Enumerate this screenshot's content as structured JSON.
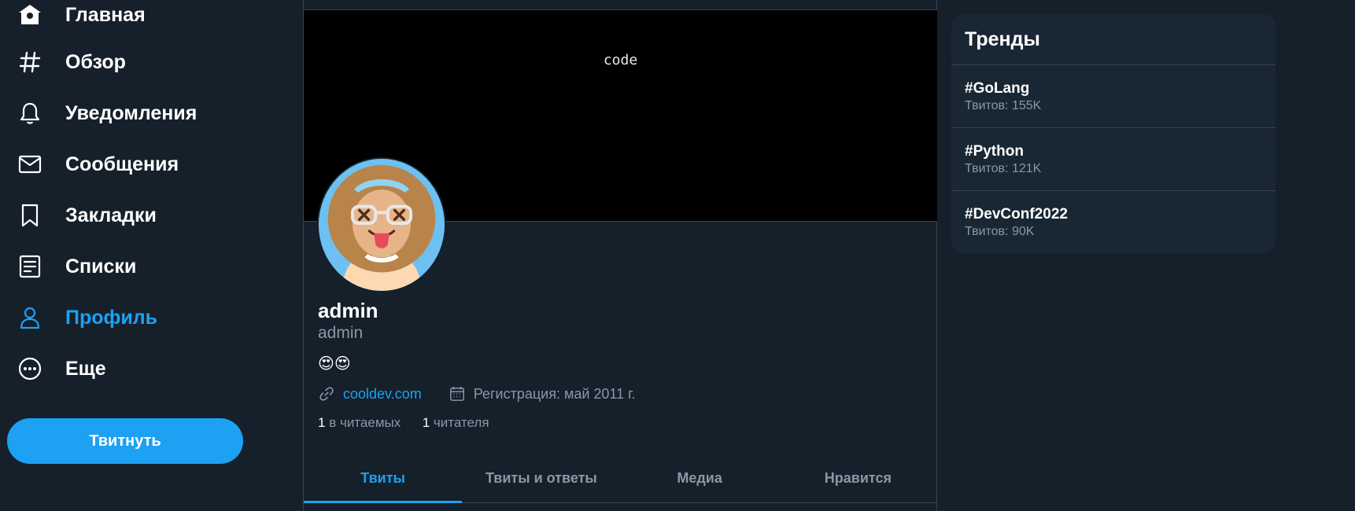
{
  "nav": {
    "items": [
      {
        "label": "Главная",
        "icon": "home-icon"
      },
      {
        "label": "Обзор",
        "icon": "hashtag-icon"
      },
      {
        "label": "Уведомления",
        "icon": "bell-icon"
      },
      {
        "label": "Сообщения",
        "icon": "mail-icon"
      },
      {
        "label": "Закладки",
        "icon": "bookmark-icon"
      },
      {
        "label": "Списки",
        "icon": "list-icon"
      },
      {
        "label": "Профиль",
        "icon": "user-icon",
        "active": true
      },
      {
        "label": "Еще",
        "icon": "more-icon"
      }
    ],
    "tweet_button": "Твитнуть"
  },
  "profile": {
    "banner_text": "code",
    "name": "admin",
    "handle": "admin",
    "bio": "😍😍",
    "website": "cooldev.com",
    "joined": "Регистрация: май 2011 г.",
    "following_count": "1",
    "following_label": "в читаемых",
    "followers_count": "1",
    "followers_label": "читателя"
  },
  "tabs": [
    {
      "label": "Твиты",
      "active": true
    },
    {
      "label": "Твиты и ответы"
    },
    {
      "label": "Медиа"
    },
    {
      "label": "Нравится"
    }
  ],
  "trends": {
    "title": "Тренды",
    "items": [
      {
        "tag": "#GoLang",
        "count": "Твитов: 155K"
      },
      {
        "tag": "#Python",
        "count": "Твитов: 121K"
      },
      {
        "tag": "#DevConf2022",
        "count": "Твитов: 90K"
      }
    ]
  },
  "colors": {
    "background": "#15202b",
    "accent": "#1da1f2",
    "muted": "#8899a6",
    "border": "#38444d"
  }
}
